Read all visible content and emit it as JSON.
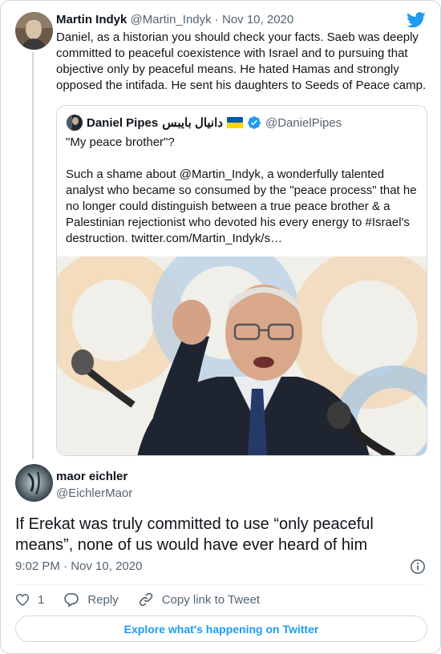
{
  "colors": {
    "twitter_blue": "#1d9bf0",
    "muted": "#536471",
    "border": "#cfd9de",
    "text": "#0f1419"
  },
  "parent_tweet": {
    "author_name": "Martin Indyk",
    "handle": "@Martin_Indyk",
    "separator": " · ",
    "date": "Nov 10, 2020",
    "text": "Daniel, as a historian you should check your facts. Saeb was deeply committed to peaceful coexistence with Israel and to pursuing that objective only by peaceful means. He hated Hamas and strongly opposed the intifada. He sent his daughters to Seeds of Peace camp."
  },
  "quoted_tweet": {
    "author_name": "Daniel Pipes",
    "author_name_arabic": "دانيال بايبس",
    "handle": "@DanielPipes",
    "text": "\"My peace brother\"?\n\nSuch a shame about @Martin_Indyk, a wonderfully talented analyst who became so consumed by the \"peace process\" that he no longer could distinguish between a true peace brother & a Palestinian rejectionist who devoted his every energy to #Israel's destruction. twitter.com/Martin_Indyk/s…"
  },
  "reply_tweet": {
    "author_name": "maor eichler",
    "handle": "@EichlerMaor",
    "text": "If Erekat was truly committed to use “only peaceful means”, none of us would have ever heard of him",
    "time": "9:02 PM",
    "separator": " · ",
    "date": "Nov 10, 2020"
  },
  "actions": {
    "like_count": "1",
    "reply_label": "Reply",
    "copy_link_label": "Copy link to Tweet"
  },
  "explore_label": "Explore what's happening on Twitter",
  "icons": {
    "brand": "twitter-bird-icon",
    "verified": "verified-badge-icon",
    "flag": "ukraine-flag-icon",
    "info": "info-icon",
    "like": "heart-icon",
    "reply": "speech-bubble-icon",
    "link": "link-icon"
  }
}
